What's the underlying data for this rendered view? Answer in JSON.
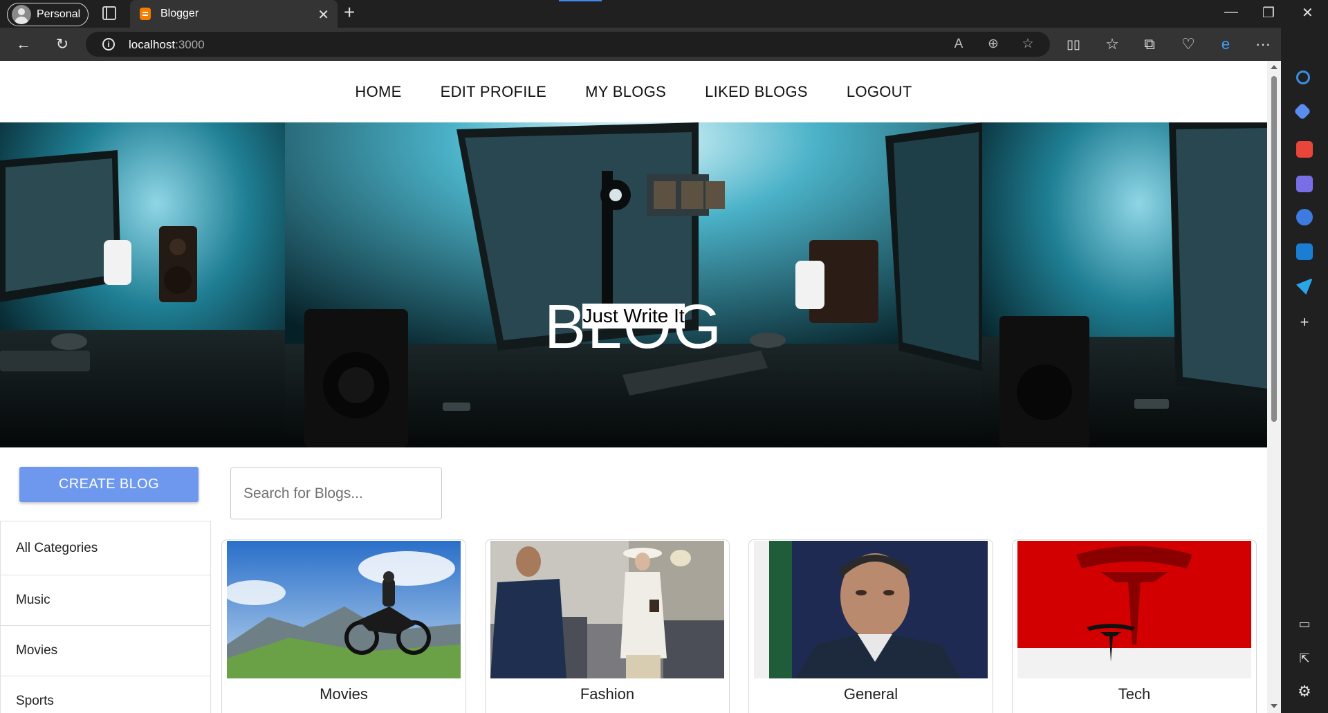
{
  "browser": {
    "profile_label": "Personal",
    "tab_title": "Blogger",
    "url_host": "localhost",
    "url_port": ":3000"
  },
  "nav": {
    "items": [
      "HOME",
      "EDIT PROFILE",
      "MY BLOGS",
      "LIKED BLOGS",
      "LOGOUT"
    ]
  },
  "hero": {
    "title": "BLOG",
    "subtitle": "Just Write It"
  },
  "actions": {
    "create_label": "CREATE BLOG",
    "search_placeholder": "Search for Blogs..."
  },
  "categories": [
    "All Categories",
    "Music",
    "Movies",
    "Sports"
  ],
  "cards": [
    {
      "label": "Movies"
    },
    {
      "label": "Fashion"
    },
    {
      "label": "General"
    },
    {
      "label": "Tech"
    }
  ],
  "colors": {
    "accent": "#6d98ee",
    "chrome_dark": "#202020",
    "brand_orange": "#f57d00"
  }
}
